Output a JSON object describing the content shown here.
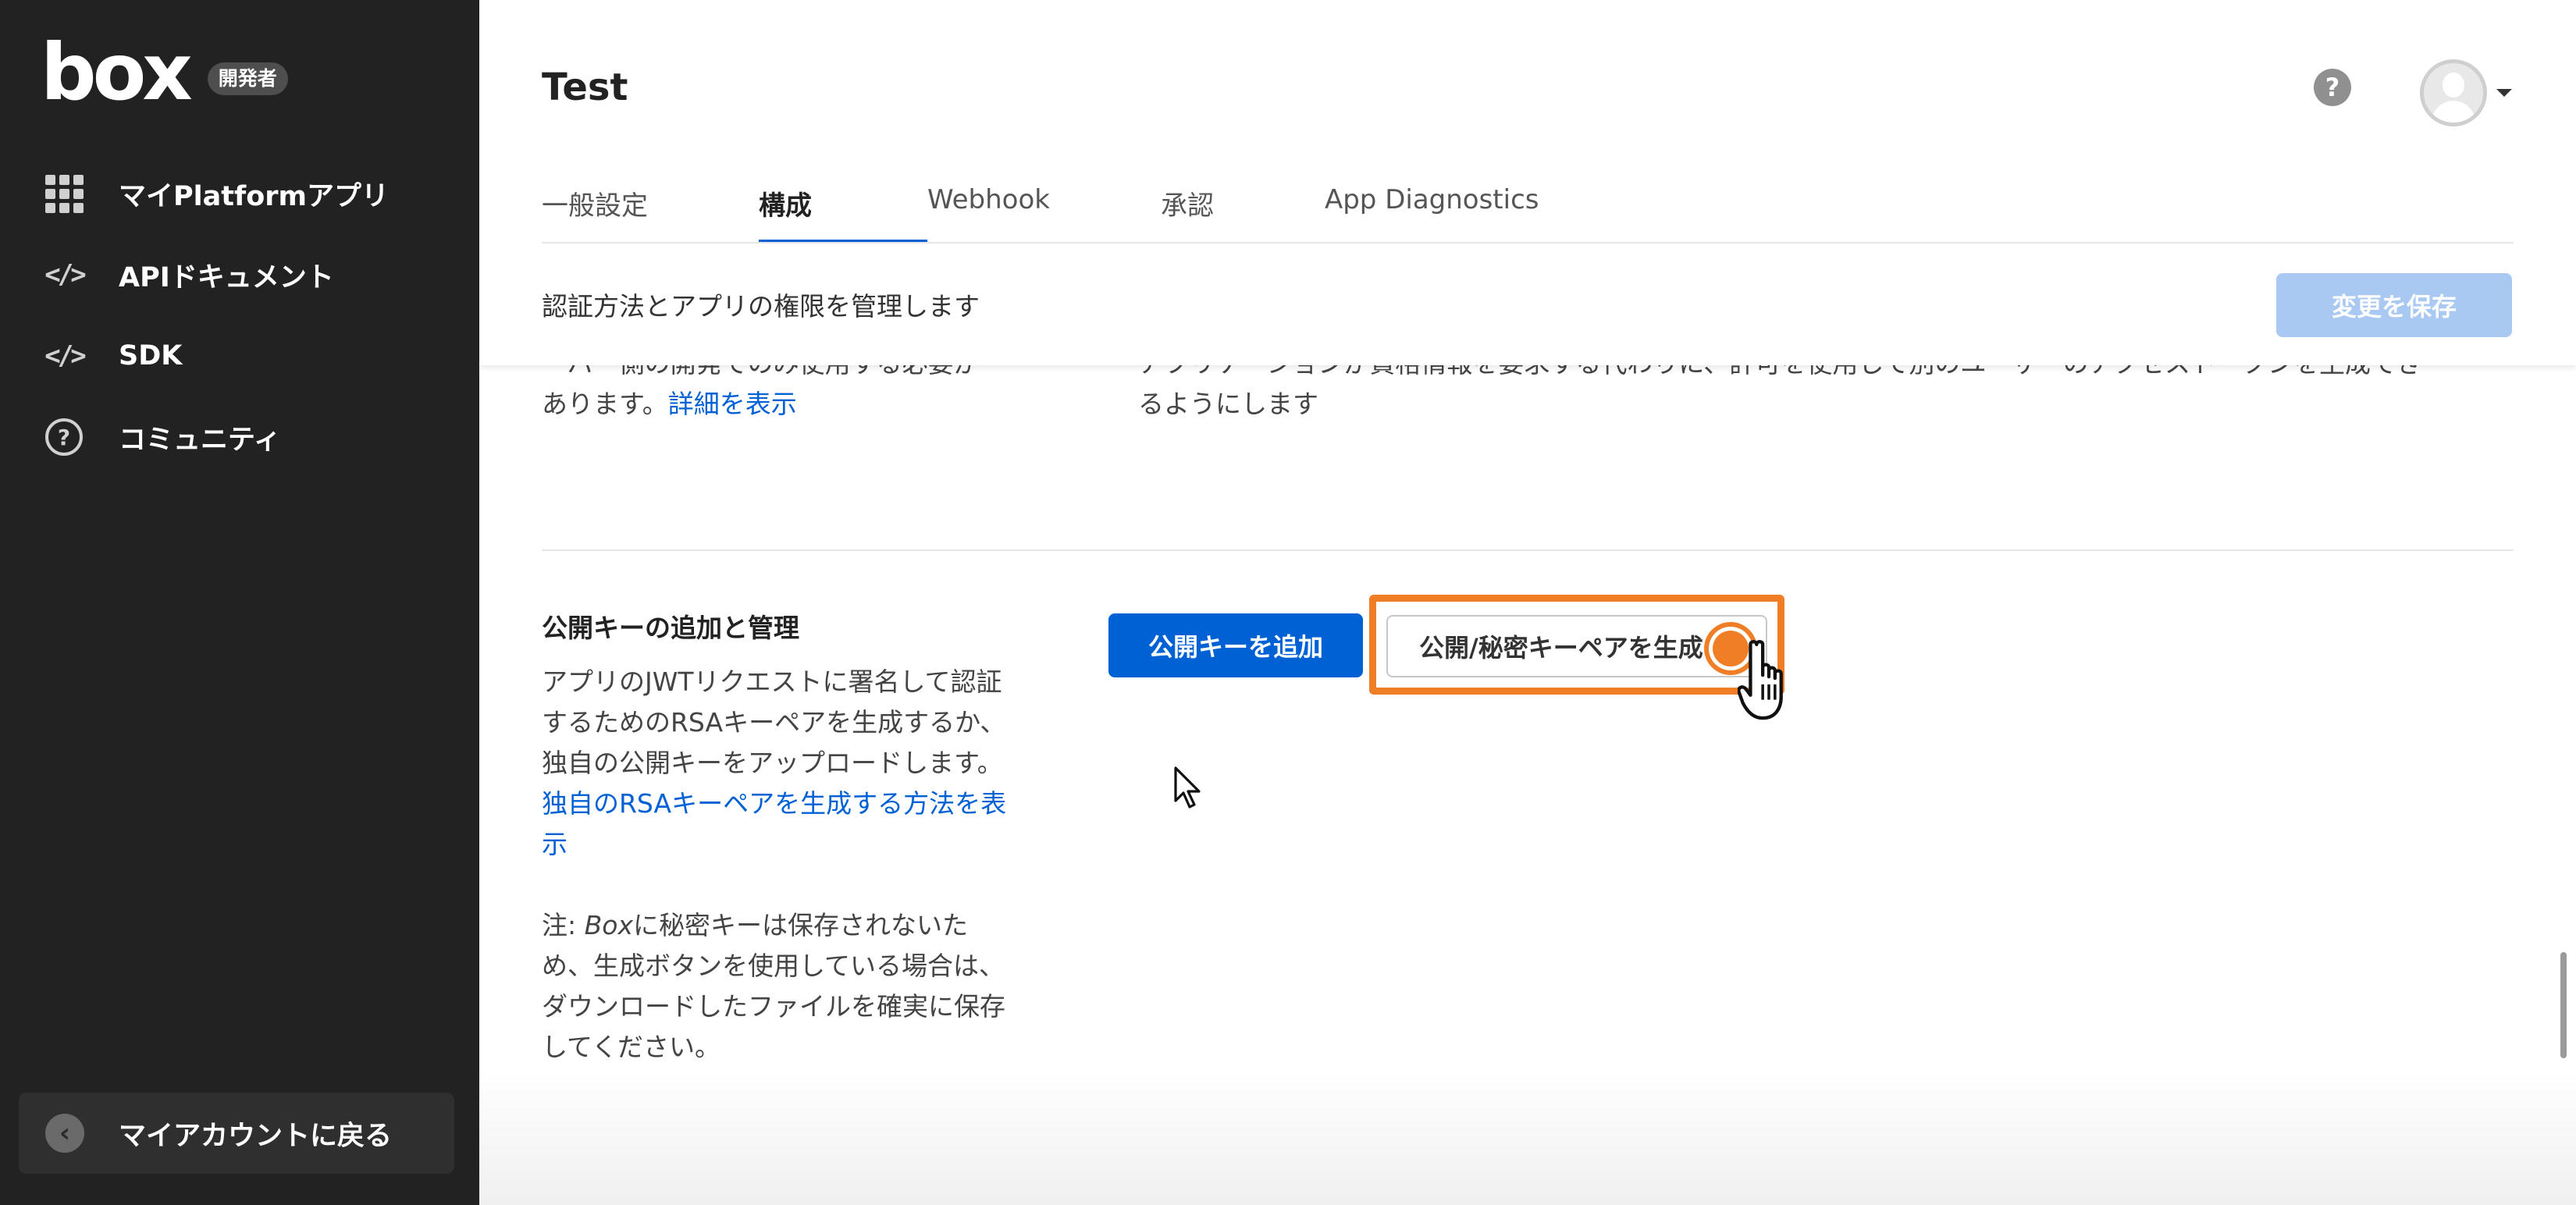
{
  "brand": {
    "logo_text": "box",
    "badge": "開発者"
  },
  "sidebar": {
    "items": [
      {
        "label": "マイPlatformアプリ",
        "icon": "apps-grid-icon"
      },
      {
        "label": "APIドキュメント",
        "icon": "code-icon",
        "glyph": "</>"
      },
      {
        "label": "SDK",
        "icon": "code-icon",
        "glyph": "</>"
      },
      {
        "label": "コミュニティ",
        "icon": "help-circle-icon",
        "glyph": "?"
      }
    ],
    "back_label": "マイアカウントに戻る",
    "back_glyph": "‹"
  },
  "header": {
    "title": "Test",
    "help_glyph": "?"
  },
  "tabs": [
    {
      "label": "一般設定"
    },
    {
      "label": "構成",
      "active": true
    },
    {
      "label": "Webhook"
    },
    {
      "label": "承認"
    },
    {
      "label": "App Diagnostics"
    }
  ],
  "subheader": {
    "text": "認証方法とアプリの権限を管理します",
    "save_label": "変更を保存"
  },
  "previous_section": {
    "left_text_1": "ーバー側の開発でのみ使用する必要が",
    "left_text_2": "あります。",
    "left_link": "詳細を表示",
    "right_text_1": "アプリケーションが資格情報を要求する代わりに、許可を使用して別のユーザーのアクセストークンを生成でき",
    "right_text_2": "るようにします"
  },
  "public_key_section": {
    "title": "公開キーの追加と管理",
    "description": "アプリのJWTリクエストに署名して認証するためのRSAキーペアを生成するか、独自の公開キーをアップロードします。",
    "description_link": "独自のRSAキーペアを生成する方法を表示",
    "note_prefix": "注: ",
    "note_brand": "Box",
    "note_text": "に秘密キーは保存されないため、生成ボタンを使用している場合は、ダウンロードしたファイルを確実に保存してください。",
    "add_key_label": "公開キーを追加",
    "generate_key_label": "公開/秘密キーペアを生成"
  },
  "colors": {
    "sidebar_bg": "#222222",
    "primary_blue": "#0061d5",
    "disabled_blue": "#a9c9f3",
    "highlight_orange": "#f07e26"
  }
}
